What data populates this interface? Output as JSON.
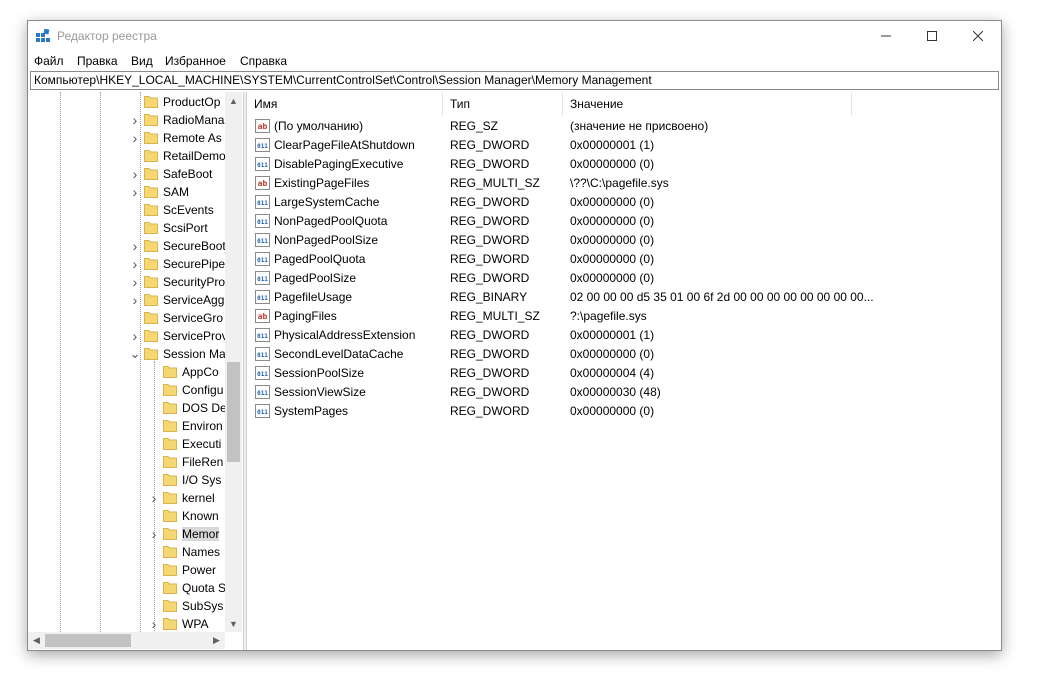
{
  "window": {
    "title": "Редактор реестра"
  },
  "menu": [
    "Файл",
    "Правка",
    "Вид",
    "Избранное",
    "Справка"
  ],
  "address": "Компьютер\\HKEY_LOCAL_MACHINE\\SYSTEM\\CurrentControlSet\\Control\\Session Manager\\Memory Management",
  "tree": [
    {
      "label": "ProductOp",
      "level": 2,
      "expander": "",
      "selected": false
    },
    {
      "label": "RadioMana",
      "level": 2,
      "expander": "right",
      "selected": false
    },
    {
      "label": "Remote As",
      "level": 2,
      "expander": "right",
      "selected": false
    },
    {
      "label": "RetailDemo",
      "level": 2,
      "expander": "",
      "selected": false
    },
    {
      "label": "SafeBoot",
      "level": 2,
      "expander": "right",
      "selected": false
    },
    {
      "label": "SAM",
      "level": 2,
      "expander": "right",
      "selected": false
    },
    {
      "label": "ScEvents",
      "level": 2,
      "expander": "",
      "selected": false
    },
    {
      "label": "ScsiPort",
      "level": 2,
      "expander": "",
      "selected": false
    },
    {
      "label": "SecureBoot",
      "level": 2,
      "expander": "right",
      "selected": false
    },
    {
      "label": "SecurePipe",
      "level": 2,
      "expander": "right",
      "selected": false
    },
    {
      "label": "SecurityPro",
      "level": 2,
      "expander": "right",
      "selected": false
    },
    {
      "label": "ServiceAgg",
      "level": 2,
      "expander": "right",
      "selected": false
    },
    {
      "label": "ServiceGro",
      "level": 2,
      "expander": "",
      "selected": false
    },
    {
      "label": "ServiceProv",
      "level": 2,
      "expander": "right",
      "selected": false
    },
    {
      "label": "Session Ma",
      "level": 2,
      "expander": "down",
      "selected": false
    },
    {
      "label": "AppCo",
      "level": 3,
      "expander": "",
      "selected": false
    },
    {
      "label": "Configu",
      "level": 3,
      "expander": "",
      "selected": false
    },
    {
      "label": "DOS De",
      "level": 3,
      "expander": "",
      "selected": false
    },
    {
      "label": "Environ",
      "level": 3,
      "expander": "",
      "selected": false
    },
    {
      "label": "Executi",
      "level": 3,
      "expander": "",
      "selected": false
    },
    {
      "label": "FileRen",
      "level": 3,
      "expander": "",
      "selected": false
    },
    {
      "label": "I/O Sys",
      "level": 3,
      "expander": "",
      "selected": false
    },
    {
      "label": "kernel",
      "level": 3,
      "expander": "right",
      "selected": false
    },
    {
      "label": "Known",
      "level": 3,
      "expander": "",
      "selected": false
    },
    {
      "label": "Memor",
      "level": 3,
      "expander": "right",
      "selected": true
    },
    {
      "label": "Names",
      "level": 3,
      "expander": "",
      "selected": false
    },
    {
      "label": "Power",
      "level": 3,
      "expander": "",
      "selected": false
    },
    {
      "label": "Quota S",
      "level": 3,
      "expander": "",
      "selected": false
    },
    {
      "label": "SubSys",
      "level": 3,
      "expander": "",
      "selected": false
    },
    {
      "label": "WPA",
      "level": 3,
      "expander": "right",
      "selected": false
    }
  ],
  "columns": {
    "name": "Имя",
    "type": "Тип",
    "value": "Значение"
  },
  "values": [
    {
      "icon": "string-value-icon",
      "name": "(По умолчанию)",
      "type": "REG_SZ",
      "data": "(значение не присвоено)"
    },
    {
      "icon": "binary-value-icon",
      "name": "ClearPageFileAtShutdown",
      "type": "REG_DWORD",
      "data": "0x00000001 (1)"
    },
    {
      "icon": "binary-value-icon",
      "name": "DisablePagingExecutive",
      "type": "REG_DWORD",
      "data": "0x00000000 (0)"
    },
    {
      "icon": "string-value-icon",
      "name": "ExistingPageFiles",
      "type": "REG_MULTI_SZ",
      "data": "\\??\\C:\\pagefile.sys"
    },
    {
      "icon": "binary-value-icon",
      "name": "LargeSystemCache",
      "type": "REG_DWORD",
      "data": "0x00000000 (0)"
    },
    {
      "icon": "binary-value-icon",
      "name": "NonPagedPoolQuota",
      "type": "REG_DWORD",
      "data": "0x00000000 (0)"
    },
    {
      "icon": "binary-value-icon",
      "name": "NonPagedPoolSize",
      "type": "REG_DWORD",
      "data": "0x00000000 (0)"
    },
    {
      "icon": "binary-value-icon",
      "name": "PagedPoolQuota",
      "type": "REG_DWORD",
      "data": "0x00000000 (0)"
    },
    {
      "icon": "binary-value-icon",
      "name": "PagedPoolSize",
      "type": "REG_DWORD",
      "data": "0x00000000 (0)"
    },
    {
      "icon": "binary-value-icon",
      "name": "PagefileUsage",
      "type": "REG_BINARY",
      "data": "02 00 00 00 d5 35 01 00 6f 2d 00 00 00 00 00 00 00 00..."
    },
    {
      "icon": "string-value-icon",
      "name": "PagingFiles",
      "type": "REG_MULTI_SZ",
      "data": "?:\\pagefile.sys"
    },
    {
      "icon": "binary-value-icon",
      "name": "PhysicalAddressExtension",
      "type": "REG_DWORD",
      "data": "0x00000001 (1)"
    },
    {
      "icon": "binary-value-icon",
      "name": "SecondLevelDataCache",
      "type": "REG_DWORD",
      "data": "0x00000000 (0)"
    },
    {
      "icon": "binary-value-icon",
      "name": "SessionPoolSize",
      "type": "REG_DWORD",
      "data": "0x00000004 (4)"
    },
    {
      "icon": "binary-value-icon",
      "name": "SessionViewSize",
      "type": "REG_DWORD",
      "data": "0x00000030 (48)"
    },
    {
      "icon": "binary-value-icon",
      "name": "SystemPages",
      "type": "REG_DWORD",
      "data": "0x00000000 (0)"
    }
  ],
  "colors": {
    "folder": "#f7d774",
    "folderEdge": "#d9b44a",
    "selection": "#d9d9d9",
    "iconBlue": "#1a5fb4",
    "iconRed": "#c0392b"
  }
}
